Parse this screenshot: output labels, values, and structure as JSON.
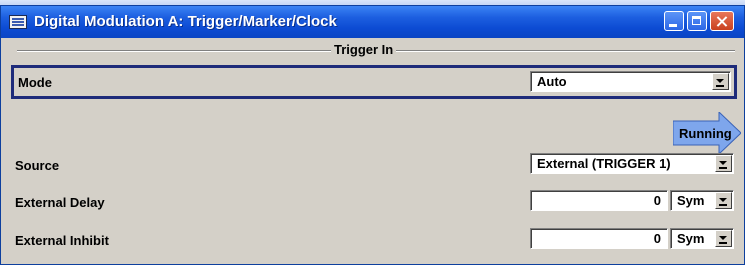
{
  "window": {
    "title": "Digital Modulation  A: Trigger/Marker/Clock",
    "titlebar_color": "#0c4bd3"
  },
  "section": {
    "title": "Trigger In"
  },
  "mode": {
    "label": "Mode",
    "value": "Auto"
  },
  "status": {
    "label": "Running",
    "color": "#7ea6ec"
  },
  "source": {
    "label": "Source",
    "value": "External (TRIGGER 1)"
  },
  "external_delay": {
    "label": "External Delay",
    "value": "0",
    "unit": "Sym"
  },
  "external_inhibit": {
    "label": "External Inhibit",
    "value": "0",
    "unit": "Sym"
  }
}
